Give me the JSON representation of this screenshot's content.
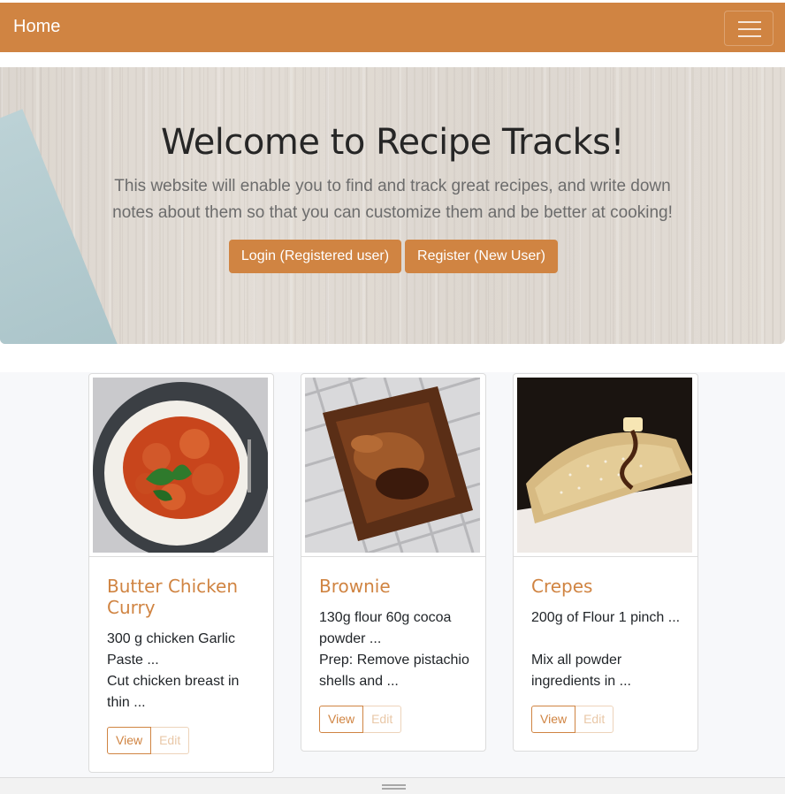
{
  "navbar": {
    "brand": "Home",
    "toggler_icon": "hamburger-icon"
  },
  "hero": {
    "title": "Welcome to Recipe Tracks!",
    "subtitle": "This website will enable you to find and track great recipes, and write down notes about them so that you can customize them and be better at cooking!",
    "login_label": "Login (Registered user)",
    "register_label": "Register (New User)"
  },
  "colors": {
    "accent": "#d08442",
    "card_border": "#dcdcdc",
    "band_bg": "#f7f8fa"
  },
  "recipes": [
    {
      "title": "Butter Chicken Curry",
      "ingredients": "300 g chicken Garlic Paste ...",
      "prep": "Cut chicken breast in thin ...",
      "view_label": "View",
      "edit_label": "Edit"
    },
    {
      "title": "Brownie",
      "ingredients": "130g flour 60g cocoa powder ...",
      "prep": "Prep: Remove pistachio shells and ...",
      "view_label": "View",
      "edit_label": "Edit"
    },
    {
      "title": "Crepes",
      "ingredients": "200g of Flour 1 pinch ...",
      "prep": "Mix all powder ingredients in ...",
      "view_label": "View",
      "edit_label": "Edit"
    }
  ]
}
